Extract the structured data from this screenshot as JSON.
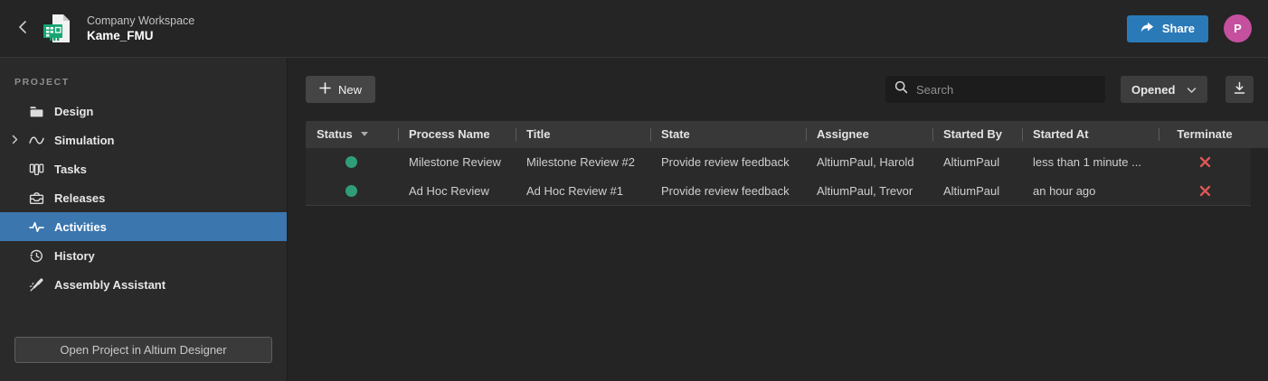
{
  "topbar": {
    "workspace_label": "Company Workspace",
    "project_name": "Kame_FMU",
    "share_label": "Share",
    "avatar_initial": "P"
  },
  "sidebar": {
    "section_label": "PROJECT",
    "items": [
      {
        "label": "Design",
        "icon": "folder-icon"
      },
      {
        "label": "Simulation",
        "icon": "waveform-icon"
      },
      {
        "label": "Tasks",
        "icon": "kanban-icon"
      },
      {
        "label": "Releases",
        "icon": "inbox-icon"
      },
      {
        "label": "Activities",
        "icon": "activity-pulse-icon",
        "active": true
      },
      {
        "label": "History",
        "icon": "history-clock-icon"
      },
      {
        "label": "Assembly Assistant",
        "icon": "soldering-iron-icon"
      }
    ],
    "open_project_label": "Open Project in Altium Designer"
  },
  "toolbar": {
    "new_label": "New",
    "search_placeholder": "Search",
    "filter_value": "Opened"
  },
  "table": {
    "columns": [
      "Status",
      "Process Name",
      "Title",
      "State",
      "Assignee",
      "Started By",
      "Started At",
      "Terminate"
    ],
    "sorted_by": "Status",
    "rows": [
      {
        "status": "active",
        "process_name": "Milestone Review",
        "title": "Milestone Review #2",
        "state": "Provide review feedback",
        "assignee": "AltiumPaul, Harold",
        "started_by": "AltiumPaul",
        "started_at": "less than 1 minute ..."
      },
      {
        "status": "active",
        "process_name": "Ad Hoc Review",
        "title": "Ad Hoc Review #1",
        "state": "Provide review feedback",
        "assignee": "AltiumPaul, Trevor",
        "started_by": "AltiumPaul",
        "started_at": "an hour ago"
      }
    ]
  },
  "colors": {
    "accent_blue": "#3b76ae",
    "share_blue": "#2a7ab8",
    "avatar_pink": "#c4509e",
    "status_green": "#2f9e78",
    "terminate_red": "#e05656"
  }
}
